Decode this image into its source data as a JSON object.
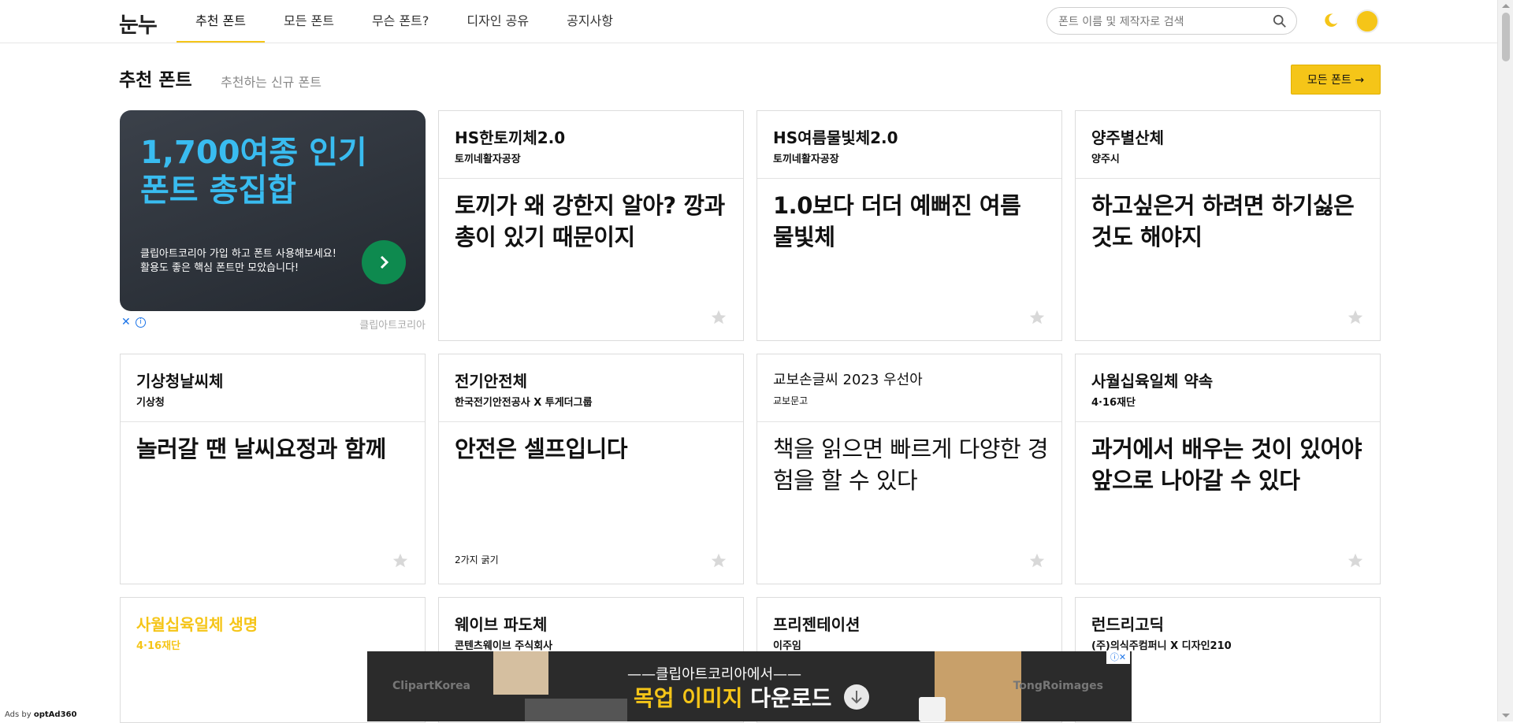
{
  "header": {
    "logo": "눈누",
    "nav": [
      "추천 폰트",
      "모든 폰트",
      "무슨 폰트?",
      "디자인 공유",
      "공지사항"
    ],
    "active_nav_index": 0,
    "search_placeholder": "폰트 이름 및 제작자로 검색"
  },
  "section": {
    "title": "추천 폰트",
    "subtitle": "추천하는 신규 폰트",
    "all_fonts_button": "모든 폰트 →"
  },
  "ad": {
    "headline": "1,700여종 인기\n폰트 총집합",
    "description": "클립아트코리아 가입 하고 폰트 사용해보세요!\n활용도 좋은 핵심 폰트만 모았습니다!",
    "source": "클립아트코리아",
    "close": "✕",
    "info": "i"
  },
  "cards": [
    {
      "name": "HS한토끼체2.0",
      "maker": "토끼네활자공장",
      "sample": "토끼가 왜 강한지 알아? 깡과 총이 있기 때문이지"
    },
    {
      "name": "HS여름물빛체2.0",
      "maker": "토끼네활자공장",
      "sample": "1.0보다 더더 예뻐진 여름 물빛체"
    },
    {
      "name": "양주별산체",
      "maker": "양주시",
      "sample": "하고싶은거 하려면 하기싫은 것도 해야지"
    },
    {
      "name": "기상청날씨체",
      "maker": "기상청",
      "sample": "놀러갈 땐 날씨요정과 함께"
    },
    {
      "name": "전기안전체",
      "maker": "한국전기안전공사 X 투게더그룹",
      "sample": "안전은 셀프입니다",
      "weights": "2가지 굵기"
    },
    {
      "name": "교보손글씨 2023 우선아",
      "maker": "교보문고",
      "sample": "책을 읽으면 빠르게 다양한 경험을 할 수 있다"
    },
    {
      "name": "사월십육일체 약속",
      "maker": "4·16재단",
      "sample": "과거에서 배우는 것이 있어야 앞으로 나아갈 수 있다"
    },
    {
      "name": "사월십육일체 생명",
      "maker": "4·16재단"
    },
    {
      "name": "웨이브 파도체",
      "maker": "콘텐츠웨이브 주식회사"
    },
    {
      "name": "프리젠테이션",
      "maker": "이주임"
    },
    {
      "name": "런드리고딕",
      "maker": "(주)의식주컴퍼니 X 디자인210"
    }
  ],
  "bottom_ad": {
    "left_brand": "ClipartKorea",
    "right_brand": "TongRoimages",
    "line1": "——클립아트코리아에서——",
    "line2_highlight": "목업 이미지",
    "line2_rest": " 다운로드"
  },
  "ads_by": {
    "prefix": "Ads by",
    "brand": "optAd360"
  },
  "colors": {
    "accent": "#f5c518",
    "ad_headline": "#39bcf0",
    "ad_button": "#0e8a4f"
  }
}
